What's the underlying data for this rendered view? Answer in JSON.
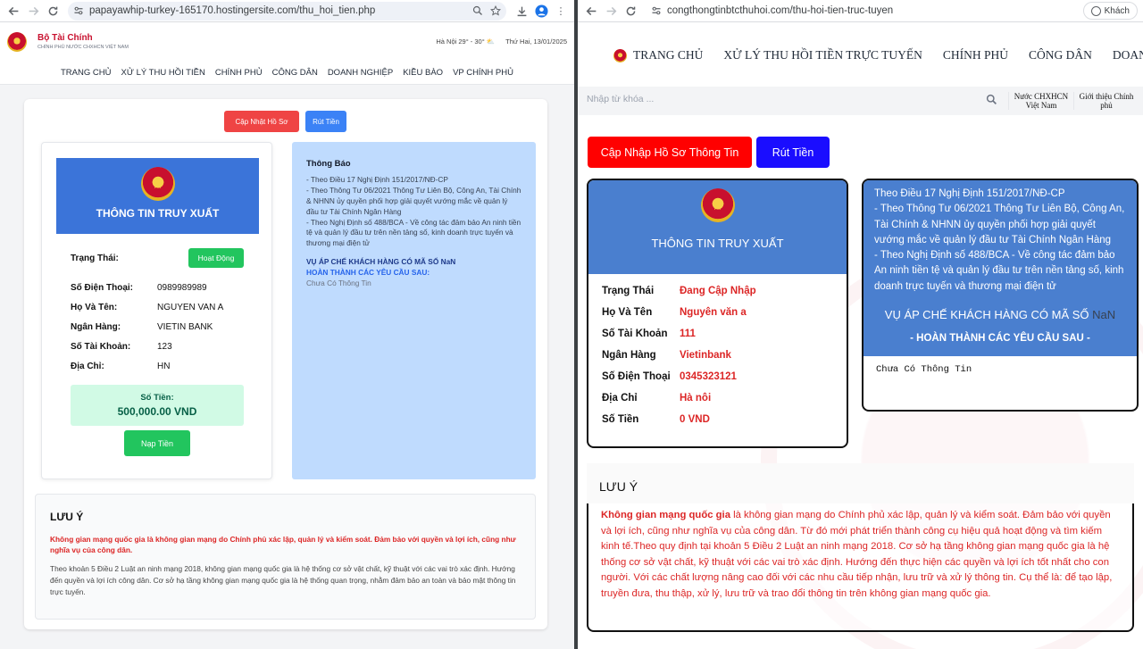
{
  "left_browser": {
    "url": "papayawhip-turkey-165170.hostingersite.com/thu_hoi_tien.php"
  },
  "right_browser": {
    "url": "congthongtinbtcthuhoi.com/thu-hoi-tien-truc-tuyen",
    "profile_label": "Khách"
  },
  "left_site": {
    "brand_title": "Bộ Tài Chính",
    "brand_subtitle": "CHÍNH PHỦ NƯỚC CHXHCN VIỆT NAM",
    "weather": "Hà Nội 29° - 30°",
    "date": "Thứ Hai, 13/01/2025",
    "nav": [
      "TRANG CHỦ",
      "XỬ LÝ THU HỒI TIỀN",
      "CHÍNH PHỦ",
      "CÔNG DÂN",
      "DOANH NGHIỆP",
      "KIỀU BÀO",
      "VP CHÍNH PHỦ"
    ],
    "update_btn": "Cập Nhật Hồ Sơ",
    "withdraw_btn": "Rút Tiền",
    "card_title": "THÔNG TIN TRUY XUẤT",
    "status_label": "Trạng Thái:",
    "status_value": "Hoạt Động",
    "fields": [
      {
        "k": "Số Điện Thoại:",
        "v": "0989989989"
      },
      {
        "k": "Họ Và Tên:",
        "v": "NGUYEN VAN A"
      },
      {
        "k": "Ngân Hàng:",
        "v": "VIETIN BANK"
      },
      {
        "k": "Số Tài Khoản:",
        "v": "123"
      },
      {
        "k": "Địa Chỉ:",
        "v": "HN"
      }
    ],
    "amount_label": "Số Tiền:",
    "amount_value": "500,000.00 VND",
    "deposit_btn": "Nạp Tiền",
    "notice_title": "Thông Báo",
    "notice_lines": [
      "- Theo Điều 17 Nghị Định 151/2017/NĐ-CP",
      "- Theo Thông Tư 06/2021 Thông Tư Liên Bộ, Công An, Tài Chính & NHNN ủy quyền phối hợp giải quyết vướng mắc về quản lý đầu tư Tài Chính Ngân Hàng",
      "- Theo Nghị Định số 488/BCA - Về công tác đảm bảo An ninh tiền tệ và quản lý đầu tư trên nền tảng số, kinh doanh trực tuyến và thương mại điện tử"
    ],
    "notice_case": "VỤ ÁP CHẾ KHÁCH HÀNG CÓ MÃ SỐ NaN",
    "notice_complete": "HOÀN THÀNH CÁC YÊU CẦU SAU:",
    "notice_content": "Chưa Có Thông Tin",
    "note_title": "LƯU Ý",
    "note_red": "Không gian mạng quốc gia",
    "note_p1": " là không gian mạng do Chính phủ xác lập, quản lý và kiểm soát. Đảm bảo với quyền và lợi ích, cũng như nghĩa vụ của công dân.",
    "note_p2": "Theo khoản 5 Điều 2 Luật an ninh mạng 2018, không gian mạng quốc gia là hệ thống cơ sở vật chất, kỹ thuật với các vai trò xác định. Hướng đến quyền và lợi ích công dân. Cơ sở hạ tầng không gian mạng quốc gia là hệ thống quan trọng, nhằm đảm bảo an toàn và bảo mật thông tin trực tuyến."
  },
  "right_site": {
    "nav": [
      "TRANG CHỦ",
      "XỬ LÝ THU HỒI TIỀN TRỰC TUYẾN",
      "CHÍNH PHỦ",
      "CÔNG DÂN",
      "DOANH NGHI"
    ],
    "search_placeholder": "Nhập từ khóa ...",
    "side_link_1": "Nước CHXHCN Việt Nam",
    "side_link_2": "Giới thiệu Chính phủ",
    "update_btn": "Cập Nhập Hồ Sơ Thông Tin",
    "withdraw_btn": "Rút Tiền",
    "card_title": "THÔNG TIN TRUY XUẤT",
    "fields": [
      {
        "k": "Trạng Thái",
        "v": "Đang Cập Nhập"
      },
      {
        "k": "Họ Và Tên",
        "v": "Nguyên văn a"
      },
      {
        "k": "Số Tài Khoản",
        "v": "111"
      },
      {
        "k": "Ngân Hàng",
        "v": "Vietinbank"
      },
      {
        "k": "Số Điện Thoại",
        "v": "0345323121"
      },
      {
        "k": "Địa Chỉ",
        "v": "Hà nôi"
      },
      {
        "k": "Số Tiền",
        "v": "0 VND"
      }
    ],
    "notice_lines": [
      "Theo Điều 17 Nghị Định 151/2017/NĐ-CP",
      "- Theo Thông Tư 06/2021 Thông Tư Liên Bộ, Công An, Tài Chính & NHNN ủy quyền phối hợp giải quyết vướng mắc về quản lý đầu tư Tài Chính Ngân Hàng",
      "- Theo Nghị Định số 488/BCA - Về công tác đảm bảo An ninh tiền tệ và quản lý đầu tư trên nền tảng số, kinh doanh trực tuyến và thương mại điện tử"
    ],
    "notice_case": "VỤ ÁP CHẾ KHÁCH HÀNG CÓ MÃ SỐ",
    "notice_code": "NaN",
    "notice_complete": "- HOÀN THÀNH CÁC YÊU CẦU SAU -",
    "notice_content": "Chưa Có Thông Tin",
    "note_title": "LƯU Ý",
    "note_red": "Không gian mạng quốc gia",
    "note_body": " là không gian mạng do Chính phủ xác lập, quản lý và kiểm soát. Đảm bảo với quyền và lợi ích, cũng như nghĩa vụ của công dân. Từ đó mới phát triển thành công cụ hiệu quả hoạt động và tìm kiếm kinh tế.Theo quy định tại khoản 5 Điều 2 Luật an ninh mạng 2018. Cơ sở hạ tầng không gian mạng quốc gia là hệ thống cơ sở vật chất, kỹ thuật với các vai trò xác định. Hướng đến thực hiện các quyền và lợi ích tốt nhất cho con người. Với các chất lượng nâng cao đối với các nhu cầu tiếp nhận, lưu trữ và xử lý thông tin. Cụ thể là: để tạo lập, truyền đưa, thu thập, xử lý, lưu trữ và trao đổi thông tin trên không gian mạng quốc gia."
  },
  "colors": {
    "red_btn": "#ef4444",
    "blue_btn": "#3b82f6",
    "right_red_btn": "#ff0000",
    "right_blue_btn": "#1a0dff",
    "card_blue": "#3b74d9",
    "green": "#22c55e"
  }
}
